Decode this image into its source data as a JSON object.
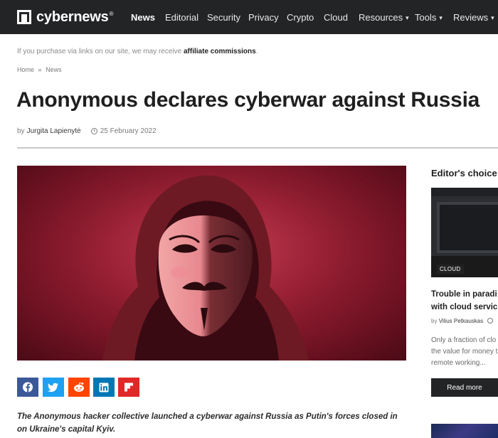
{
  "nav": {
    "logo_text": "cybernews",
    "logo_reg": "®",
    "items": [
      {
        "label": "News",
        "active": true
      },
      {
        "label": "Editorial"
      },
      {
        "label": "Security"
      },
      {
        "label": "Privacy"
      },
      {
        "label": "Crypto"
      },
      {
        "label": "Cloud"
      },
      {
        "label": "Resources",
        "dropdown": true
      },
      {
        "label": "Tools",
        "dropdown": true
      },
      {
        "label": "Reviews",
        "dropdown": true
      }
    ],
    "caret": "▾"
  },
  "affiliate": {
    "text": "If you purchase via links on our site, we may receive",
    "bold": "affiliate commissions",
    "end": "."
  },
  "breadcrumb": [
    "Home",
    "»",
    "News"
  ],
  "article": {
    "title": "Anonymous declares cyberwar against Russia",
    "by": "by",
    "author": "Jurgita Lapienytė",
    "date": "25 February 2022",
    "lead": "The Anonymous hacker collective launched a cyberwar against Russia as Putin's forces closed in on Ukraine's capital Kyiv."
  },
  "share_buttons": [
    {
      "icon": "facebook-icon",
      "color": "#3b5998"
    },
    {
      "icon": "twitter-icon",
      "color": "#1da1f2"
    },
    {
      "icon": "reddit-icon",
      "color": "#ff4500"
    },
    {
      "icon": "linkedin-icon",
      "color": "#0077b5"
    },
    {
      "icon": "flipboard-icon",
      "color": "#e12828"
    }
  ],
  "sidebar": {
    "heading": "Editor's choice",
    "badge": "CLOUD",
    "title_line1": "Trouble in paradi",
    "title_line2": "with cloud servic",
    "by": "by",
    "author": "Vilius Petkauskas",
    "excerpt_line1": "Only a fraction of clo",
    "excerpt_line2": "the value for money t",
    "excerpt_line3": "remote working...",
    "read_more": "Read more"
  }
}
